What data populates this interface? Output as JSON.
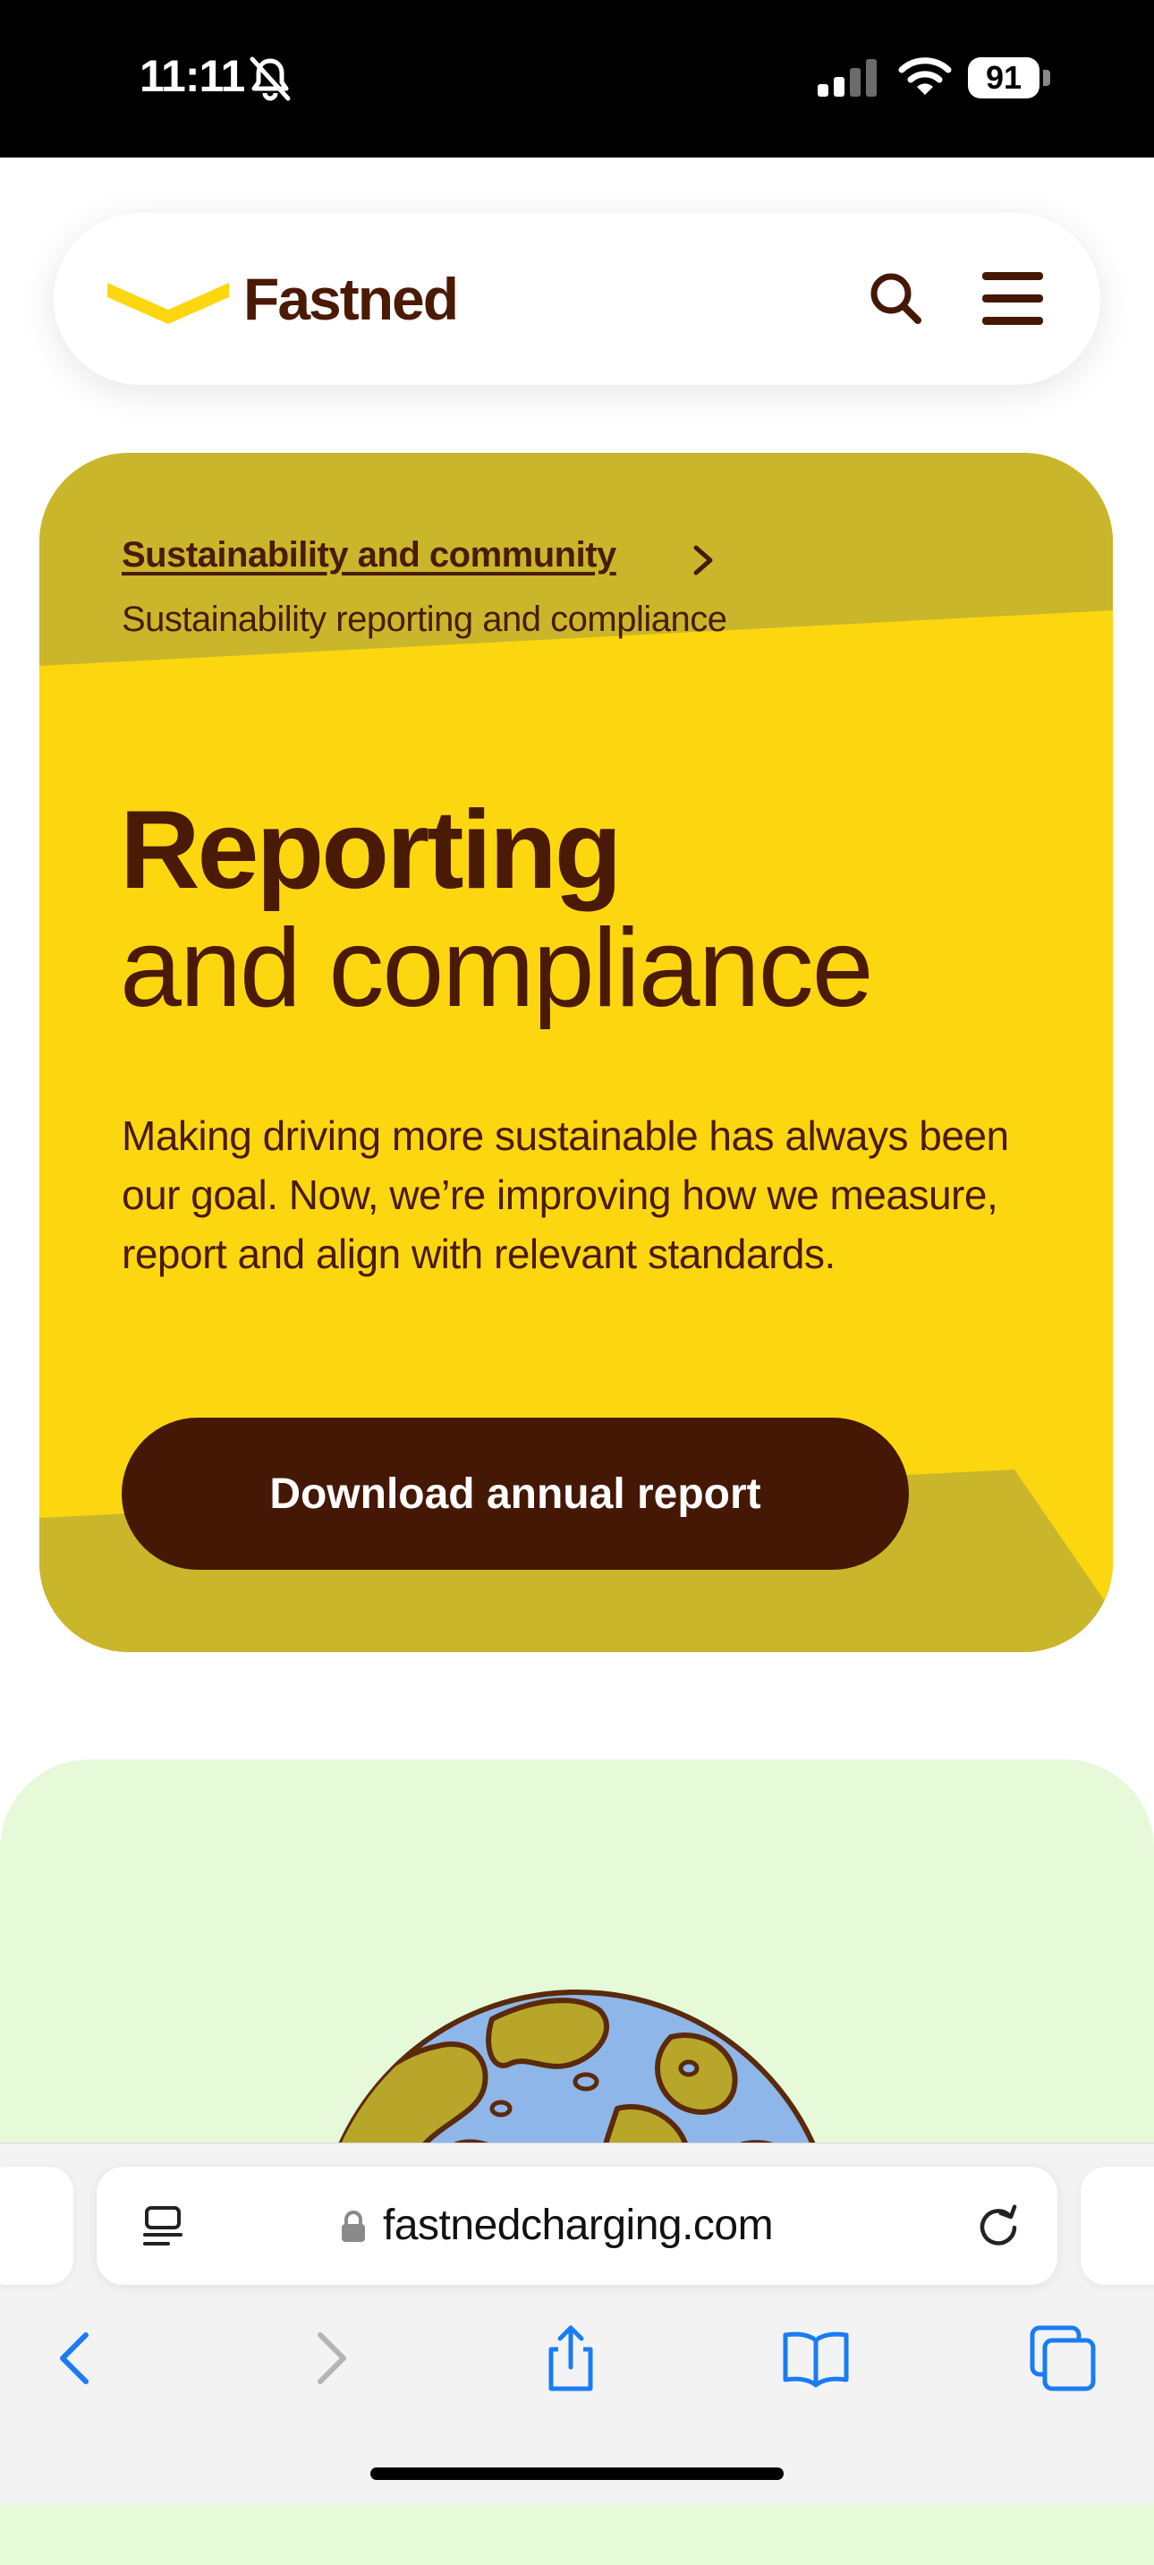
{
  "status_bar": {
    "time": "11:11",
    "battery": "91",
    "icons": [
      "bell-slash-icon",
      "cellular-signal-icon",
      "wifi-icon",
      "battery-icon"
    ]
  },
  "header": {
    "brand": "Fastned",
    "icons": [
      "fastned-logo-icon",
      "search-icon",
      "hamburger-menu-icon"
    ]
  },
  "hero": {
    "breadcrumb_parent": "Sustainability and community",
    "breadcrumb_current": "Sustainability reporting and compliance",
    "title_bold": "Reporting",
    "title_light": "and compliance",
    "description": "Making driving more sustainable has always been our goal. Now, we’re improving how we measure, report and align with relevant standards.",
    "cta_label": "Download annual report"
  },
  "illustration": {
    "icon": "globe-illustration"
  },
  "browser": {
    "url": "fastnedcharging.com",
    "toolbar_icons": [
      "back-icon",
      "forward-icon",
      "share-icon",
      "bookmarks-icon",
      "tabs-icon"
    ]
  },
  "colors": {
    "brand_yellow": "#FCD710",
    "brand_olive": "#C9B62A",
    "brand_brown": "#441804",
    "accent_blue": "#1A7CF5",
    "mint": "#E6F9D8"
  }
}
